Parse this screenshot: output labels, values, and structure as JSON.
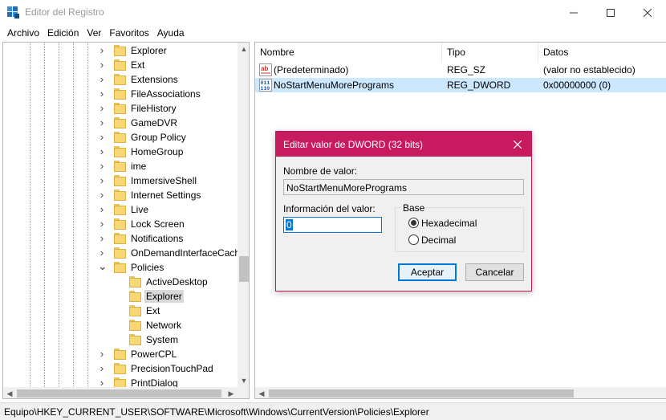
{
  "window": {
    "title": "Editor del Registro",
    "icon": "registry-editor-icon"
  },
  "menu": [
    "Archivo",
    "Edición",
    "Ver",
    "Favoritos",
    "Ayuda"
  ],
  "tree": {
    "items": [
      {
        "label": "Explorer",
        "level": 1,
        "expander": "collapsed"
      },
      {
        "label": "Ext",
        "level": 1,
        "expander": "collapsed"
      },
      {
        "label": "Extensions",
        "level": 1,
        "expander": "collapsed"
      },
      {
        "label": "FileAssociations",
        "level": 1,
        "expander": "collapsed"
      },
      {
        "label": "FileHistory",
        "level": 1,
        "expander": "collapsed"
      },
      {
        "label": "GameDVR",
        "level": 1,
        "expander": "collapsed"
      },
      {
        "label": "Group Policy",
        "level": 1,
        "expander": "collapsed"
      },
      {
        "label": "HomeGroup",
        "level": 1,
        "expander": "collapsed"
      },
      {
        "label": "ime",
        "level": 1,
        "expander": "collapsed"
      },
      {
        "label": "ImmersiveShell",
        "level": 1,
        "expander": "collapsed"
      },
      {
        "label": "Internet Settings",
        "level": 1,
        "expander": "collapsed"
      },
      {
        "label": "Live",
        "level": 1,
        "expander": "collapsed"
      },
      {
        "label": "Lock Screen",
        "level": 1,
        "expander": "collapsed"
      },
      {
        "label": "Notifications",
        "level": 1,
        "expander": "collapsed"
      },
      {
        "label": "OnDemandInterfaceCach",
        "level": 1,
        "expander": "collapsed"
      },
      {
        "label": "Policies",
        "level": 1,
        "expander": "expanded"
      },
      {
        "label": "ActiveDesktop",
        "level": 2,
        "expander": "none"
      },
      {
        "label": "Explorer",
        "level": 2,
        "expander": "none",
        "selected": true
      },
      {
        "label": "Ext",
        "level": 2,
        "expander": "none"
      },
      {
        "label": "Network",
        "level": 2,
        "expander": "none"
      },
      {
        "label": "System",
        "level": 2,
        "expander": "none"
      },
      {
        "label": "PowerCPL",
        "level": 1,
        "expander": "collapsed"
      },
      {
        "label": "PrecisionTouchPad",
        "level": 1,
        "expander": "collapsed"
      },
      {
        "label": "PrintDialog",
        "level": 1,
        "expander": "collapsed"
      }
    ]
  },
  "list": {
    "columns": {
      "name": "Nombre",
      "type": "Tipo",
      "data": "Datos"
    },
    "rows": [
      {
        "icon": "string-value-icon",
        "name": "(Predeterminado)",
        "type": "REG_SZ",
        "data": "(valor no establecido)"
      },
      {
        "icon": "binary-value-icon",
        "name": "NoStartMenuMorePrograms",
        "type": "REG_DWORD",
        "data": "0x00000000 (0)",
        "highlight": true
      }
    ]
  },
  "status": {
    "path": "Equipo\\HKEY_CURRENT_USER\\SOFTWARE\\Microsoft\\Windows\\CurrentVersion\\Policies\\Explorer"
  },
  "dialog": {
    "title": "Editar valor de DWORD (32 bits)",
    "value_name_label": "Nombre de valor:",
    "value_name": "NoStartMenuMorePrograms",
    "value_data_label": "Información del valor:",
    "value_data": "0",
    "base_label": "Base",
    "radio_hex": "Hexadecimal",
    "radio_dec": "Decimal",
    "selected_base": "Hexadecimal",
    "ok": "Aceptar",
    "cancel": "Cancelar",
    "accent_color": "#c81b5f"
  }
}
